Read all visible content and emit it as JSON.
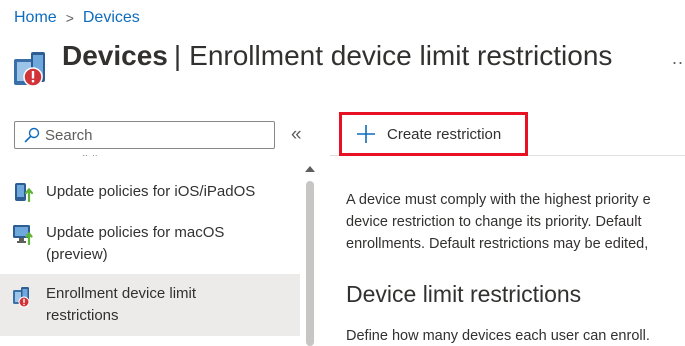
{
  "breadcrumb": {
    "home": "Home",
    "separator": ">",
    "devices": "Devices"
  },
  "header": {
    "title_strong": "Devices",
    "title_pipe": "|",
    "title_rest": "Enrollment device limit restrictions",
    "more_label": "..."
  },
  "search": {
    "placeholder": "Search"
  },
  "collapse_label": "«",
  "nav": {
    "cutoff_text": "‘‘ ’’",
    "items": [
      {
        "label_line1": "Update policies for iOS/iPadOS",
        "label_line2": "",
        "icon": "ios-update-icon"
      },
      {
        "label_line1": "Update policies for macOS",
        "label_line2": "(preview)",
        "icon": "macos-update-icon"
      },
      {
        "label_line1": "Enrollment device limit",
        "label_line2": "restrictions",
        "icon": "enrollment-restriction-icon",
        "selected": true
      }
    ]
  },
  "toolbar": {
    "create_label": "Create restriction"
  },
  "content": {
    "description_lines": [
      "A device must comply with the highest priority e",
      "device restriction to change its priority. Default",
      "enrollments. Default restrictions may be edited,"
    ],
    "section_title": "Device limit restrictions",
    "section_description": "Define how many devices each user can enroll."
  },
  "colors": {
    "link": "#0f6cbd",
    "highlight_border": "#e81123",
    "selected_bg": "#edebe9",
    "text": "#323130"
  }
}
